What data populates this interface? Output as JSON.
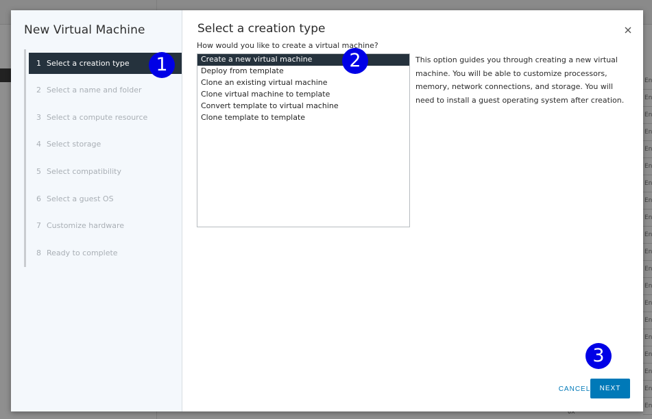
{
  "background": {
    "rows": [
      "Ena",
      "Ena",
      "Ena",
      "Ena",
      "Ena",
      "Ena",
      "Ena",
      "Ena",
      "Ena",
      "Ena",
      "Ena",
      "Ena",
      "Ena",
      "Ena",
      "Ena",
      "Ena",
      "Ena",
      "Ena",
      "Ena",
      "Ena"
    ],
    "bottom_text": "0X"
  },
  "wizard": {
    "title": "New Virtual Machine",
    "steps": [
      {
        "num": "1",
        "label": "Select a creation type",
        "state": "active"
      },
      {
        "num": "2",
        "label": "Select a name and folder",
        "state": "disabled"
      },
      {
        "num": "3",
        "label": "Select a compute resource",
        "state": "disabled"
      },
      {
        "num": "4",
        "label": "Select storage",
        "state": "disabled"
      },
      {
        "num": "5",
        "label": "Select compatibility",
        "state": "disabled"
      },
      {
        "num": "6",
        "label": "Select a guest OS",
        "state": "disabled"
      },
      {
        "num": "7",
        "label": "Customize hardware",
        "state": "disabled"
      },
      {
        "num": "8",
        "label": "Ready to complete",
        "state": "disabled"
      }
    ]
  },
  "content": {
    "title": "Select a creation type",
    "question": "How would you like to create a virtual machine?",
    "options": [
      "Create a new virtual machine",
      "Deploy from template",
      "Clone an existing virtual machine",
      "Clone virtual machine to template",
      "Convert template to virtual machine",
      "Clone template to template"
    ],
    "selected_index": 0,
    "description": "This option guides you through creating a new virtual machine. You will be able to customize processors, memory, network connections, and storage. You will need to install a guest operating system after creation."
  },
  "footer": {
    "cancel_label": "CANCEL",
    "next_label": "NEXT"
  },
  "annotations": [
    "1",
    "2",
    "3"
  ],
  "colors": {
    "accent": "#0079b8",
    "selected_bg": "#25323d",
    "badge": "#0000e6"
  }
}
